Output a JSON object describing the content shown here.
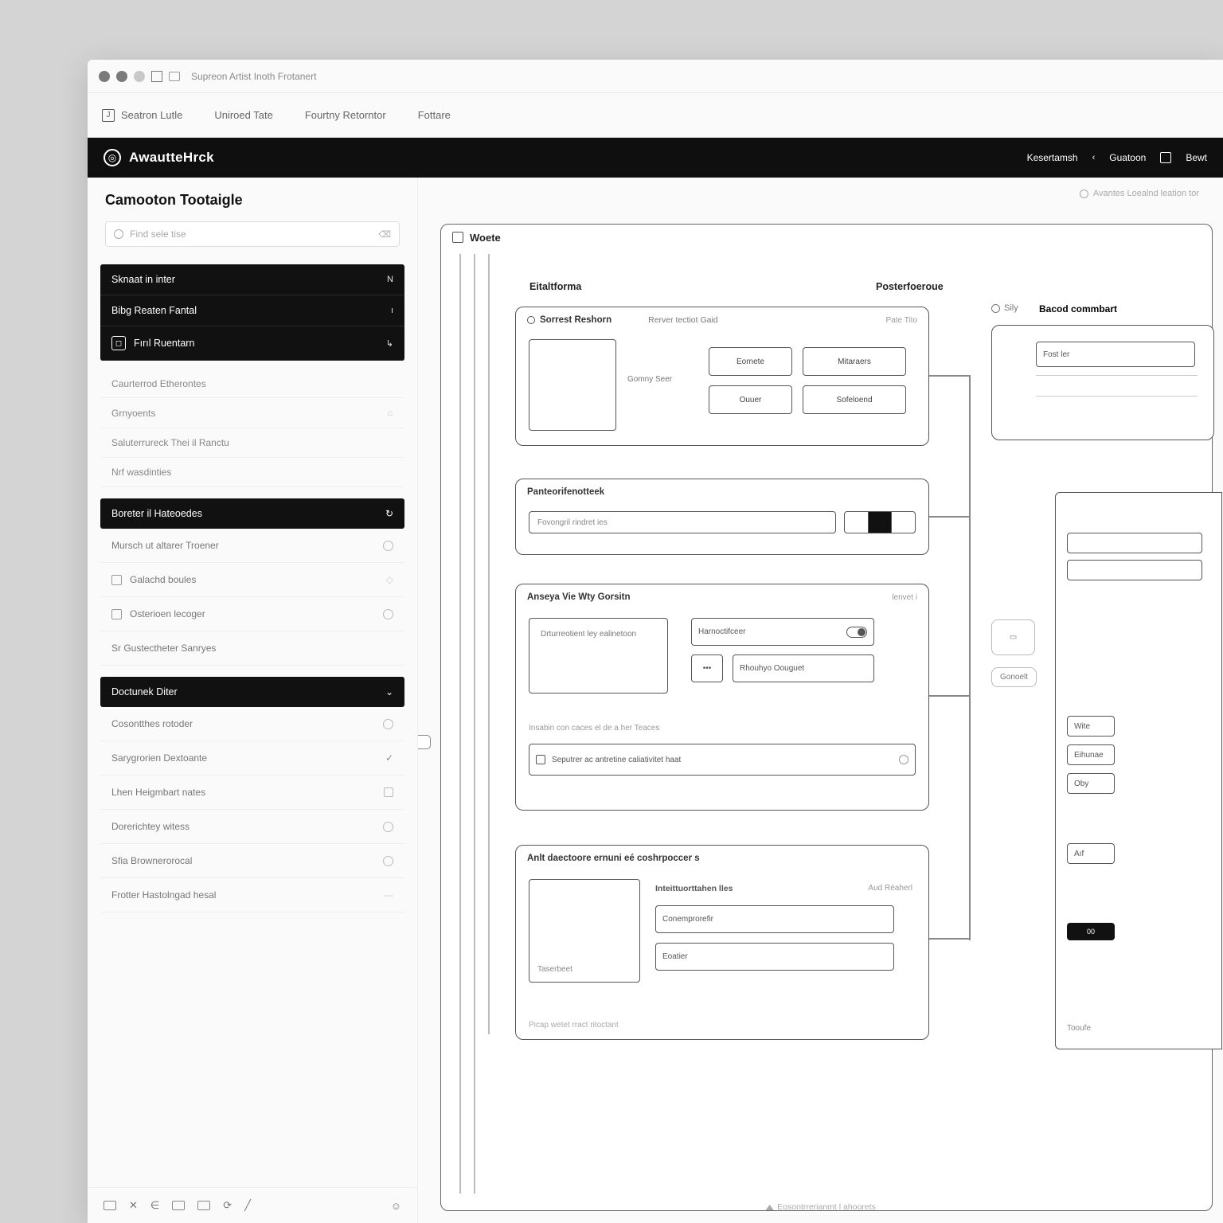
{
  "titlebar": {
    "title": "Supreon Artist Inoth Frotanert"
  },
  "tabs": [
    "Seatron Lutle",
    "Uniroed Tate",
    "Fourtny Retorntor",
    "Fottare"
  ],
  "brand": "AwautteHrck",
  "topnav": {
    "left": "Kesertamsh",
    "mid": "Guatoon",
    "right": "Bewt"
  },
  "sidebar": {
    "title": "Camooton Tootaigle",
    "search_placeholder": "Find sele tise",
    "search_hint": "⌫",
    "group1": [
      {
        "label": "Sknaat in inter",
        "rt": "N"
      },
      {
        "label": "Bibg Reaten Fantal",
        "rt": "ı"
      },
      {
        "label": "Fırıl Ruentarn",
        "rt": "↳",
        "icon": true
      }
    ],
    "group2_head": "Caurterrod Etherontes",
    "group2": [
      {
        "label": "Grnyoents",
        "rt": "○"
      },
      {
        "label": "Saluterrureck Thei il Ranctu",
        "rt": ""
      },
      {
        "label": "Nrf wasdinties",
        "rt": ""
      }
    ],
    "group3_head": "Boreter il Hateoedes",
    "group3": [
      {
        "label": "Mursch ut altarer Troener",
        "rt": "○"
      },
      {
        "label": "Galachd boules",
        "rt": "◇",
        "box": true
      },
      {
        "label": "Osterioen lecoger",
        "rt": "○",
        "box": true
      },
      {
        "label": "Sr Gustectheter Sanryes",
        "rt": ""
      }
    ],
    "group4_head": "Doctunek Diter",
    "group4": [
      {
        "label": "Cosontthes rotoder",
        "rt": "○"
      },
      {
        "label": "Sarygrorien Dextoante",
        "rt": "✓"
      },
      {
        "label": "Lhen Heigmbart nates",
        "rt": "□"
      },
      {
        "label": "Dorerichtey witess",
        "rt": "○"
      },
      {
        "label": "Sfia Brownerorocal",
        "rt": "○"
      },
      {
        "label": "Frotter Hastolngad hesal",
        "rt": "—"
      }
    ],
    "bottom_tools": [
      "▭",
      "✕",
      "∈",
      "▭",
      "▢",
      "⟳",
      "✓",
      "☺"
    ]
  },
  "canvas": {
    "search_note": "Avantes Loealnd leation tor",
    "root_frame": "Woete",
    "col1": "Eitaltforma",
    "col2": "Posterfoeroue",
    "col3a": "Sily",
    "col3b": "Bacod commbart",
    "card1": {
      "head": "Sorrest Reshorn",
      "sub": "Rerver tectiot Gaid",
      "rt": "Pate Tito",
      "thumb_label": "Gomny Seer",
      "btns": [
        "Eornete",
        "Mitaraers",
        "Ouuer",
        "Sofeloend"
      ]
    },
    "card2": {
      "head": "Panteorifenotteek",
      "field": "Fovongril rindret ies"
    },
    "card3": {
      "head": "Anseya Vie Wty Gorsitn",
      "rt": "lenvet i",
      "box_label": "Drturreotient ley ealinetoon",
      "toggle_label": "Harnoctifceer",
      "list_label": "Rhouhyo Oouguet",
      "foot1": "Insabin con caces el de a her Teaces",
      "foot2": "Seputrer ac antretine caliativitet haat"
    },
    "card4": {
      "head": "Anlt daectoore ernuni eé coshrpoccer s",
      "thumb_label": "Taserbeet",
      "row_label": "Inteittuorttahen lles",
      "row_rt": "Aud Réaherl",
      "f1": "Conemprorefir",
      "f2": "Eoatier",
      "foot": "Picap wetet rract ritoctant"
    },
    "right_nodes": {
      "n1": "Fost ler",
      "n2_a": "Wite",
      "n2_b": "Eihunae",
      "n2_c": "Oby",
      "n3": "Aıf",
      "n4": "Tooufe"
    },
    "right_pill": "Gonoelt",
    "footer": "Eosontrrerianmt l ahoorets"
  }
}
